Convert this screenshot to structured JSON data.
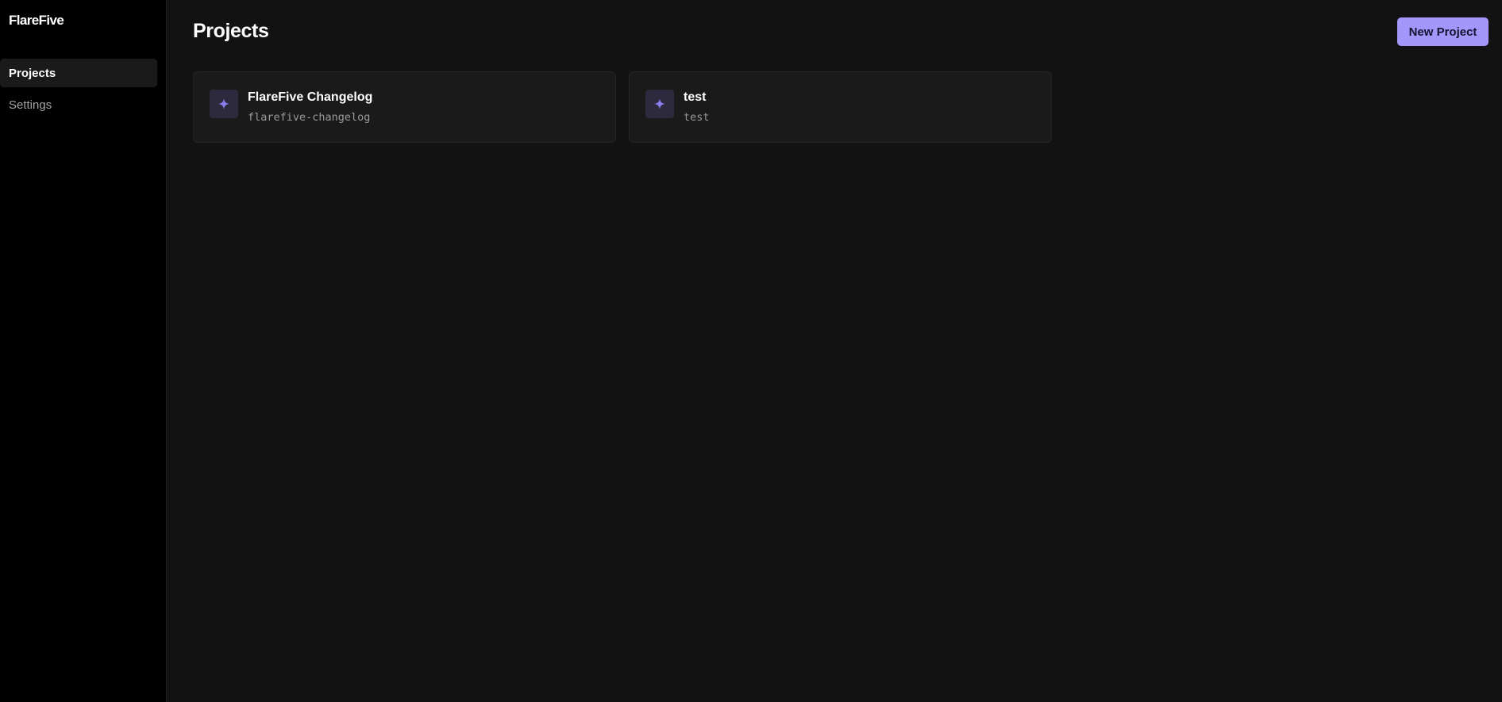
{
  "app": {
    "brand": "FlareFive"
  },
  "sidebar": {
    "items": [
      {
        "label": "Projects",
        "active": true
      },
      {
        "label": "Settings",
        "active": false
      }
    ]
  },
  "main": {
    "title": "Projects",
    "new_project_label": "New Project",
    "projects": [
      {
        "name": "FlareFive Changelog",
        "slug": "flarefive-changelog",
        "icon": "sparkle-icon"
      },
      {
        "name": "test",
        "slug": "test",
        "icon": "sparkle-icon"
      }
    ]
  },
  "colors": {
    "accent": "#a497fb",
    "icon_color": "#8b7ff0",
    "background": "#121212",
    "sidebar": "#000000",
    "card": "#1a1a1a"
  }
}
